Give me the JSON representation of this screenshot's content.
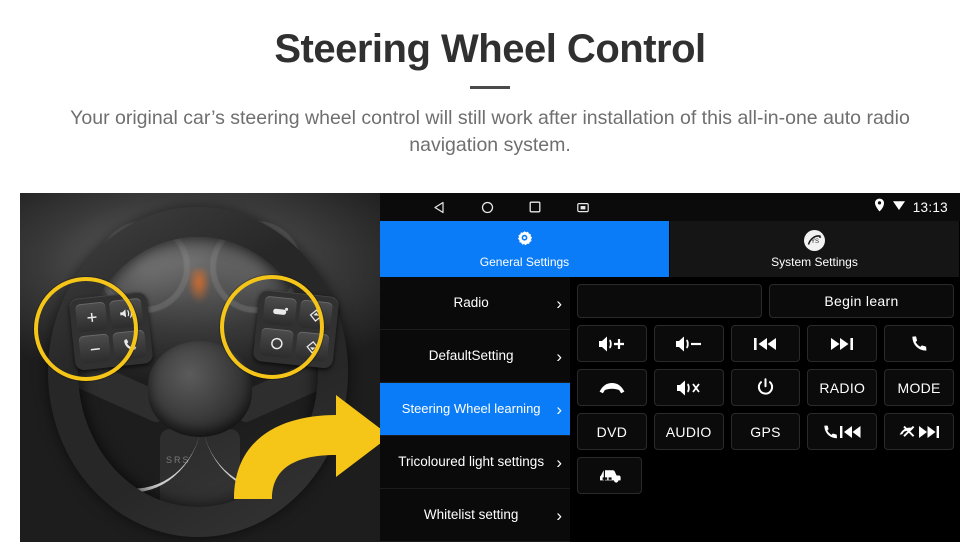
{
  "header": {
    "title": "Steering Wheel Control",
    "subtitle": "Your original car’s steering wheel control will still work after installation of this all-in-one auto radio navigation system."
  },
  "colors": {
    "accent_blue": "#0b7cf7",
    "highlight_yellow": "#f5c518",
    "panel_black": "#000000",
    "title_gray": "#303030",
    "subtitle_gray": "#6f6f6f"
  },
  "photo": {
    "description": "steering-wheel-photo",
    "left_cluster": [
      {
        "name": "volume-up-button",
        "glyph": "+"
      },
      {
        "name": "mute-speaker-button",
        "glyph": "speaker-mute-icon"
      },
      {
        "name": "volume-down-button",
        "glyph": "−"
      },
      {
        "name": "phone-call-button",
        "glyph": "phone-icon"
      }
    ],
    "right_cluster": [
      {
        "name": "cruise-control-button",
        "glyph": "cruise-icon"
      },
      {
        "name": "arrow-up-button",
        "glyph": "diamond-up-icon"
      },
      {
        "name": "circle-select-button",
        "glyph": "circle-icon"
      },
      {
        "name": "arrow-down-button",
        "glyph": "diamond-down-icon"
      }
    ],
    "airbag_text": "SRS"
  },
  "head_unit": {
    "statusbar": {
      "nav_keys": [
        "back-icon",
        "home-icon",
        "recents-icon",
        "screenshot-icon"
      ],
      "indicators": [
        "location-pin-icon",
        "wifi-icon"
      ],
      "clock": "13:13"
    },
    "tabs": [
      {
        "label": "General Settings",
        "icon": "gear-icon",
        "active": true
      },
      {
        "label": "System Settings",
        "icon": "system-logo-icon",
        "active": false
      }
    ],
    "menu": [
      {
        "label": "Radio",
        "active": false
      },
      {
        "label": "DefaultSetting",
        "active": false
      },
      {
        "label": "Steering Wheel learning",
        "active": true
      },
      {
        "label": "Tricoloured light settings",
        "active": false
      },
      {
        "label": "Whitelist setting",
        "active": false
      }
    ],
    "panel": {
      "rows": [
        [
          {
            "name": "learn-status-field",
            "label": "",
            "icon": ""
          },
          {
            "name": "begin-learn-button",
            "label": "Begin learn",
            "icon": ""
          }
        ],
        [
          {
            "name": "volume-up-button",
            "label": "",
            "icon": "volume-up-icon"
          },
          {
            "name": "volume-down-button",
            "label": "",
            "icon": "volume-down-icon"
          },
          {
            "name": "previous-track-button",
            "label": "",
            "icon": "previous-track-icon"
          },
          {
            "name": "next-track-button",
            "label": "",
            "icon": "next-track-icon"
          },
          {
            "name": "answer-call-button",
            "label": "",
            "icon": "phone-icon"
          }
        ],
        [
          {
            "name": "hang-up-button",
            "label": "",
            "icon": "phone-hangup-icon"
          },
          {
            "name": "mute-button",
            "label": "",
            "icon": "mute-icon"
          },
          {
            "name": "power-button",
            "label": "",
            "icon": "power-icon"
          },
          {
            "name": "radio-button",
            "label": "RADIO",
            "icon": ""
          },
          {
            "name": "mode-button",
            "label": "MODE",
            "icon": ""
          }
        ],
        [
          {
            "name": "dvd-button",
            "label": "DVD",
            "icon": ""
          },
          {
            "name": "audio-button",
            "label": "AUDIO",
            "icon": ""
          },
          {
            "name": "gps-button",
            "label": "GPS",
            "icon": ""
          },
          {
            "name": "call-previous-button",
            "label": "",
            "icon": "phone-previous-icon"
          },
          {
            "name": "hangup-next-button",
            "label": "",
            "icon": "hangup-next-icon"
          }
        ],
        [
          {
            "name": "vehicle-info-button",
            "label": "",
            "icon": "car-icon"
          }
        ]
      ]
    }
  }
}
